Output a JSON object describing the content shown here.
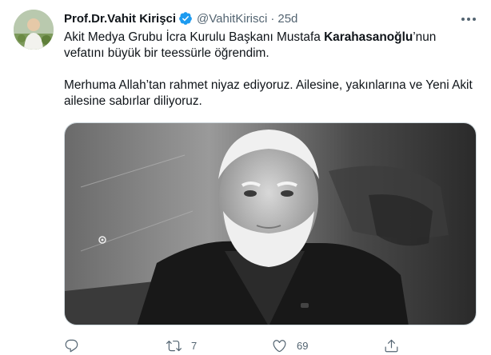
{
  "tweet": {
    "author_name": "Prof.Dr.Vahit Kirişci",
    "handle": "@VahitKirisci",
    "separator": "·",
    "age": "25d",
    "text_p1_before": "Akit Medya Grubu İcra Kurulu Başkanı Mustafa ",
    "text_p1_bold": "Karahasanoğlu",
    "text_p1_after": "’nun vefatını büyük bir teessürle öğrendim.",
    "text_p2": "Merhuma Allah’tan rahmet niyaz ediyoruz. Ailesine, yakınlarına ve Yeni Akit ailesine sabırlar diliyoruz."
  },
  "actions": {
    "reply_count": "",
    "retweet_count": "7",
    "like_count": "69"
  },
  "icons": {
    "verified": "verified-badge-icon",
    "more": "more-icon",
    "reply": "reply-icon",
    "retweet": "retweet-icon",
    "like": "heart-icon",
    "share": "share-icon"
  },
  "colors": {
    "verified": "#1d9bf0",
    "secondary_text": "#536471"
  }
}
